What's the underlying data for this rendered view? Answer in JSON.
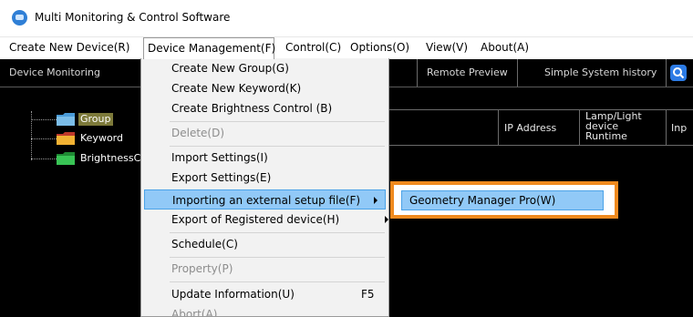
{
  "window": {
    "title": "Multi Monitoring & Control Software",
    "icon": "app-logo-icon"
  },
  "menubar": {
    "items": [
      {
        "label": "Create New Device(R)"
      },
      {
        "label": "Device Management(F)"
      },
      {
        "label": "Control(C)"
      },
      {
        "label": "Options(O)"
      },
      {
        "label": "View(V)"
      },
      {
        "label": "About(A)"
      }
    ]
  },
  "toolbar": {
    "tabs": [
      {
        "label": "Device Monitoring"
      },
      {
        "label": "Remote Preview"
      },
      {
        "label": "Simple System history"
      }
    ],
    "search_icon": "search-icon",
    "accent": "#2c7be5"
  },
  "tree": {
    "nodes": [
      {
        "label": "Group",
        "folder_color": "#4a9bd8",
        "selected": true
      },
      {
        "label": "Keyword",
        "folder_color": "#e8a020"
      },
      {
        "label": "BrightnessC",
        "folder_color": "#2fb34a"
      }
    ]
  },
  "table": {
    "headers": [
      {
        "label": "IP Address"
      },
      {
        "label": "Lamp/Light device Runtime"
      },
      {
        "label": "Inp"
      }
    ]
  },
  "dropdown": {
    "items": [
      {
        "label": "Create New Group(G)"
      },
      {
        "label": "Create New Keyword(K)"
      },
      {
        "label": "Create Brightness Control (B)"
      },
      {
        "label": "Delete(D)",
        "disabled": true
      },
      {
        "label": "Import Settings(I)"
      },
      {
        "label": "Export Settings(E)"
      },
      {
        "label": "Importing an external setup file(F)",
        "highlighted": true,
        "submenu": true
      },
      {
        "label": "Export of Registered device(H)",
        "submenu": true
      },
      {
        "label": "Schedule(C)"
      },
      {
        "label": "Property(P)",
        "disabled": true
      },
      {
        "label": "Update Information(U)",
        "shortcut": "F5"
      },
      {
        "label": "Abort(A)",
        "disabled": true
      }
    ]
  },
  "submenu": {
    "items": [
      {
        "label": "Geometry Manager Pro(W)"
      }
    ],
    "highlight_border": "#f08a1e"
  }
}
